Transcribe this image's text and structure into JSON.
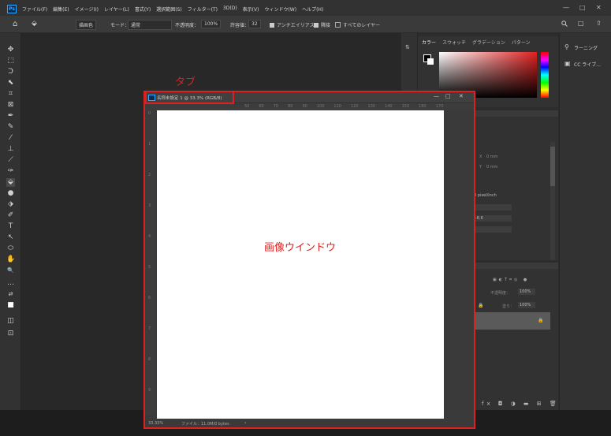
{
  "menubar": {
    "app_badge": "Ps",
    "items": [
      "ファイル(F)",
      "編集(E)",
      "イメージ(I)",
      "レイヤー(L)",
      "書式(Y)",
      "選択範囲(S)",
      "フィルター(T)",
      "3D(D)",
      "表示(V)",
      "ウィンドウ(W)",
      "ヘルプ(H)"
    ],
    "minimize": "—",
    "maximize": "□",
    "close": "✕"
  },
  "options_bar": {
    "home_icon": "⌂",
    "tool_icon": "⬙",
    "fill_source": "描画色",
    "mode_label": "モード：",
    "mode_value": "通常",
    "opacity_label": "不透明度：",
    "opacity_value": "100%",
    "tolerance_label": "許容値：",
    "tolerance_value": "32",
    "antialias": "アンチエイリアス",
    "contiguous": "隣接",
    "all_layers": "すべてのレイヤー",
    "search_icon": "search-icon",
    "workspace_icon": "□",
    "share_icon": "⇧"
  },
  "toolbar": {
    "tools": [
      "✥",
      "⬚",
      "ᑐ",
      "⬉",
      "⌗",
      "⊠",
      "✒",
      "✎",
      "⁄",
      "⊥",
      "⟋",
      "✑",
      "⬙",
      "●",
      "⬗",
      "✐",
      "T",
      "↖",
      "⬭",
      "✋",
      "🔍",
      "…",
      "⇄",
      "■",
      "◫",
      "⊡"
    ]
  },
  "color_panel": {
    "tabs": [
      "カラー",
      "スウォッチ",
      "グラデーション",
      "パターン"
    ]
  },
  "properties_panel": {
    "x_label": "X",
    "x_value": "0 mm",
    "y_label": "Y",
    "y_value": "0 mm",
    "resolution": "0 pixel/inch",
    "field1": "",
    "field2": "-8.6",
    "field3": ""
  },
  "layers_panel": {
    "opacity_label": "不透明度：",
    "opacity_value": "100%",
    "fill_label": "塗り：",
    "fill_value": "100%",
    "lock_icon": "🔒"
  },
  "farright_panel": {
    "learn_label": "ラーニング",
    "cc_label": "CC ライブ..."
  },
  "document": {
    "tab_title": "名称未設定 1 @ 33.3% (RGB/8)",
    "ruler_top": [
      "50",
      "60",
      "70",
      "80",
      "90",
      "100",
      "110",
      "120",
      "130",
      "140",
      "150",
      "160",
      "170"
    ],
    "ruler_left": [
      "0",
      "1",
      "2",
      "3",
      "4",
      "5",
      "6",
      "7",
      "8",
      "9"
    ],
    "zoom": "33.33%",
    "file_info": "ファイル：11.0M/0 bytes",
    "status_arrow": "›"
  },
  "annotations": {
    "tab_label": "タブ",
    "canvas_label": "画像ウインドウ",
    "accent_color": "#e02020"
  }
}
